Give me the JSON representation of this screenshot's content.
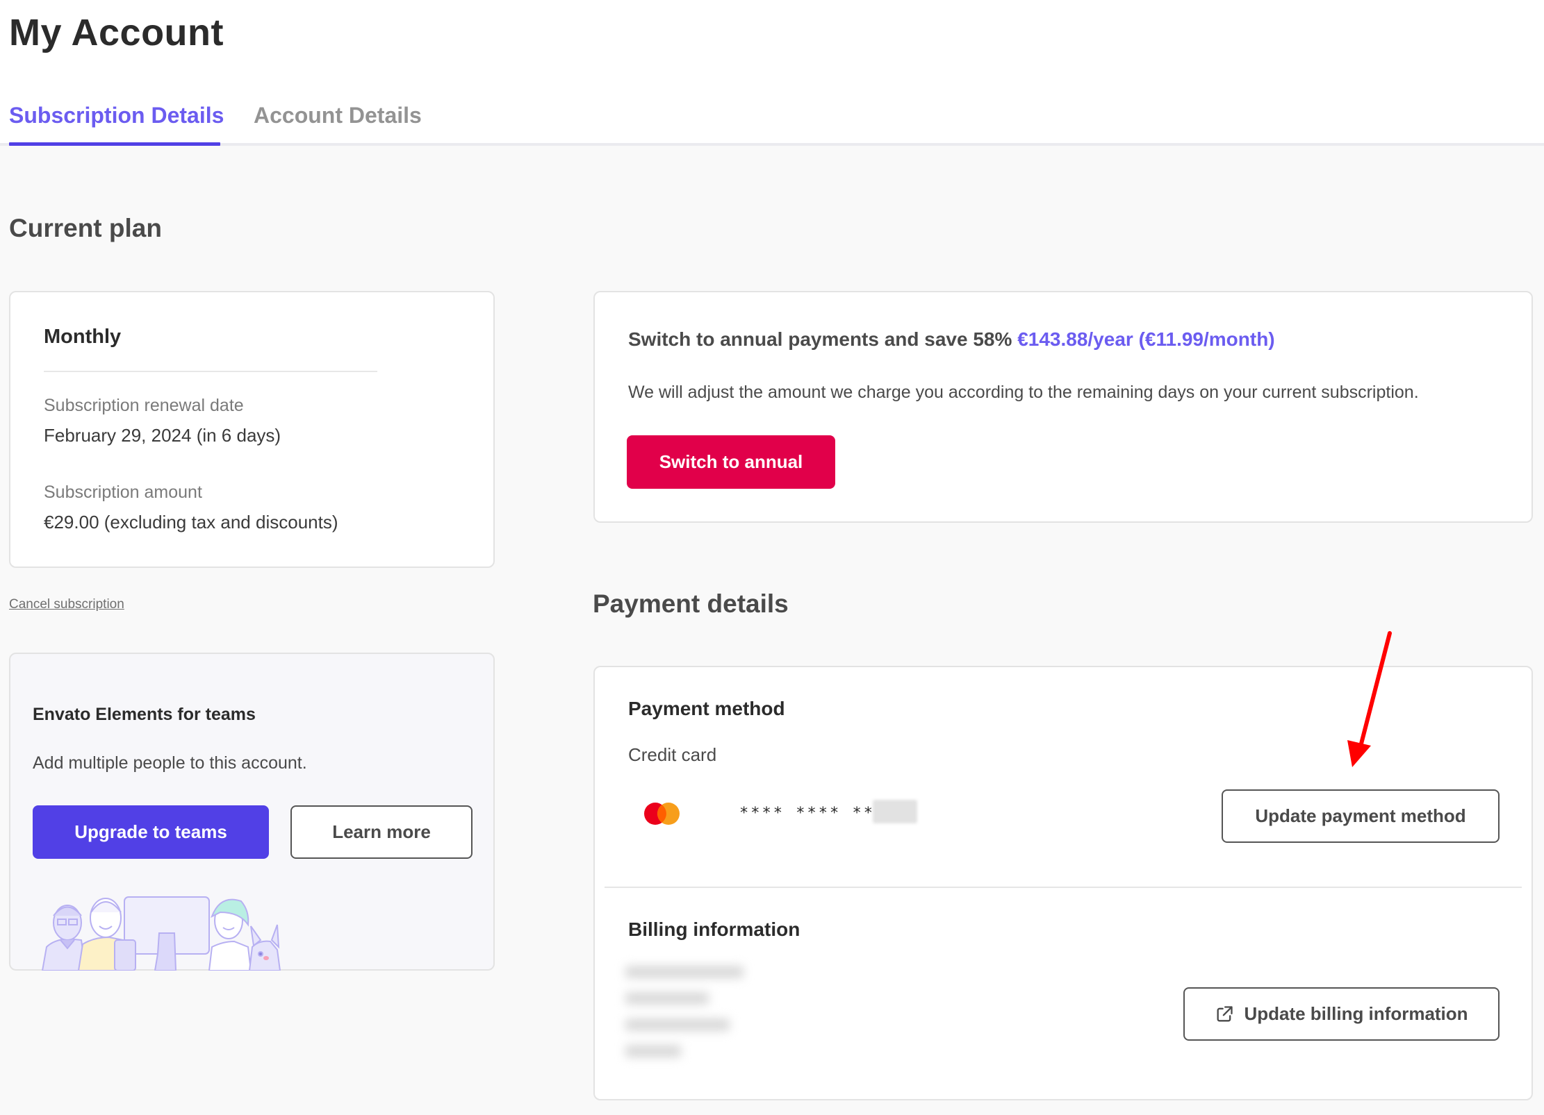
{
  "page": {
    "title": "My Account"
  },
  "tabs": [
    {
      "label": "Subscription Details",
      "active": true
    },
    {
      "label": "Account Details",
      "active": false
    }
  ],
  "colors": {
    "accent": "#5140e6",
    "accent_text": "#6b5cf0",
    "danger": "#e1004a",
    "annotation": "#ff0000"
  },
  "current_plan": {
    "heading": "Current plan",
    "plan_name": "Monthly",
    "renewal_label": "Subscription renewal date",
    "renewal_value": "February 29, 2024 (in 6 days)",
    "amount_label": "Subscription amount",
    "amount_value": "€29.00 (excluding tax and discounts)",
    "cancel_link": "Cancel subscription"
  },
  "annual_offer": {
    "headline_prefix": "Switch to annual payments and save 58%",
    "price_year": "€143.88/year",
    "price_month": "(€11.99/month)",
    "description": "We will adjust the amount we charge you according to the remaining days on your current subscription.",
    "button_label": "Switch to annual"
  },
  "teams": {
    "title": "Envato Elements for teams",
    "description": "Add multiple people to this account.",
    "upgrade_button": "Upgrade to teams",
    "learn_more_button": "Learn more",
    "illustration": "team-illustration"
  },
  "payment_details": {
    "heading": "Payment details",
    "payment_method": {
      "title": "Payment method",
      "type": "Credit card",
      "card_brand_icon": "mastercard-icon",
      "masked_number": "**** **** ****",
      "last_digits": "redacted",
      "update_button": "Update payment method"
    },
    "billing": {
      "title": "Billing information",
      "address": "redacted",
      "update_button": "Update billing information",
      "update_button_icon": "external-link-icon"
    }
  },
  "annotation": {
    "type": "arrow",
    "points_to": "Update payment method"
  }
}
